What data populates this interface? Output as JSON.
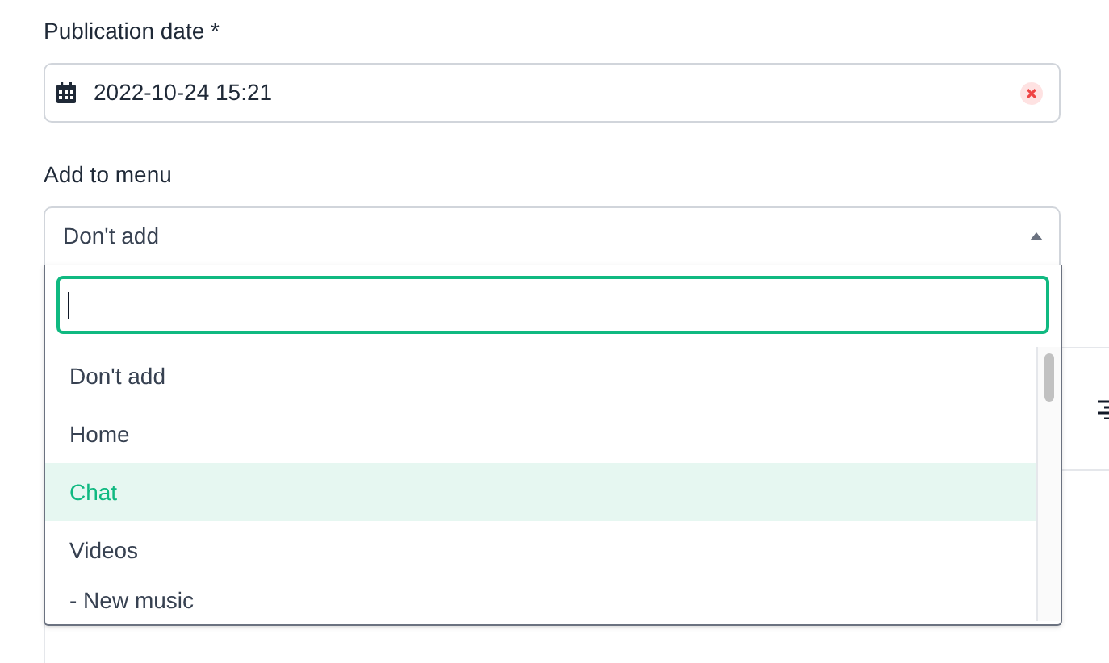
{
  "publication_date": {
    "label": "Publication date *",
    "value": "2022-10-24 15:21"
  },
  "add_to_menu": {
    "label": "Add to menu",
    "value": "Don't add",
    "expanded": true,
    "search": {
      "focused": true
    },
    "options": [
      {
        "label": "Don't add",
        "highlighted": false
      },
      {
        "label": "Home",
        "highlighted": false
      },
      {
        "label": "Chat",
        "highlighted": true
      },
      {
        "label": "Videos",
        "highlighted": false
      },
      {
        "label": "- New music",
        "highlighted": false
      }
    ]
  }
}
